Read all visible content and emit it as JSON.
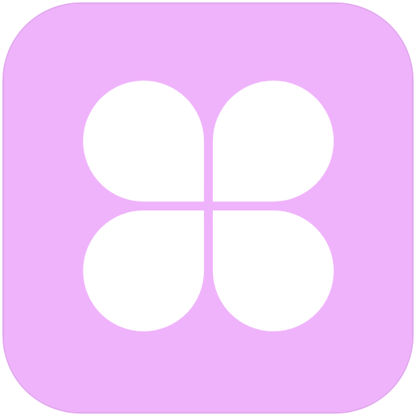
{
  "app_icon": {
    "icon": "four-petal-clover-icon",
    "tile_color": "#efb3fb",
    "border_color": "#e3a6f0",
    "glyph_color": "#ffffff"
  }
}
